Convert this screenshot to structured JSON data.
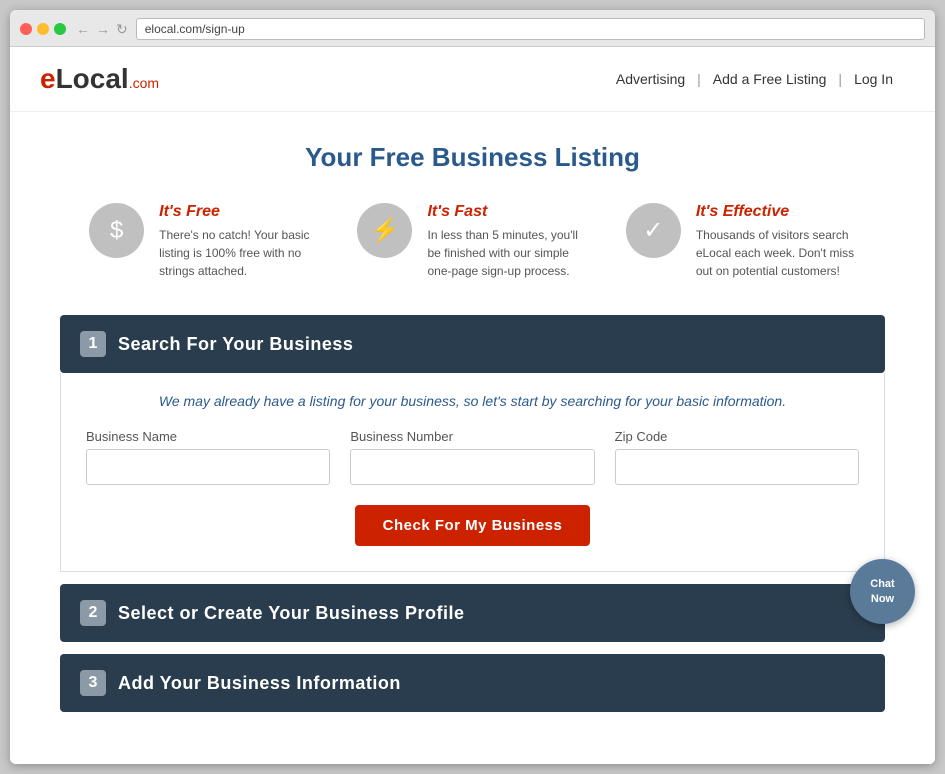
{
  "browser": {
    "url": "elocal.com/sign-up"
  },
  "header": {
    "logo": {
      "e": "e",
      "local": "Local",
      "com": ".com"
    },
    "nav": {
      "advertising": "Advertising",
      "add_listing": "Add a Free Listing",
      "login": "Log In"
    }
  },
  "page": {
    "title": "Your Free Business Listing"
  },
  "features": [
    {
      "title": "It's Free",
      "icon": "$",
      "description": "There's no catch! Your basic listing is 100% free with no strings attached."
    },
    {
      "title": "It's Fast",
      "icon": "⚡",
      "description": "In less than 5 minutes, you'll be finished with our simple one-page sign-up process."
    },
    {
      "title": "It's Effective",
      "icon": "✓",
      "description": "Thousands of visitors search eLocal each week. Don't miss out on potential customers!"
    }
  ],
  "steps": [
    {
      "number": "1",
      "title": "Search For Your Business",
      "subtitle": "We may already have a listing for your business, so let's start by searching for your basic information.",
      "fields": [
        {
          "label": "Business Name",
          "placeholder": ""
        },
        {
          "label": "Business Number",
          "placeholder": ""
        },
        {
          "label": "Zip Code",
          "placeholder": ""
        }
      ],
      "button": "Check For My Business"
    },
    {
      "number": "2",
      "title": "Select or Create Your Business Profile"
    },
    {
      "number": "3",
      "title": "Add Your Business Information"
    }
  ],
  "chat": {
    "label": "Chat\nNow"
  }
}
